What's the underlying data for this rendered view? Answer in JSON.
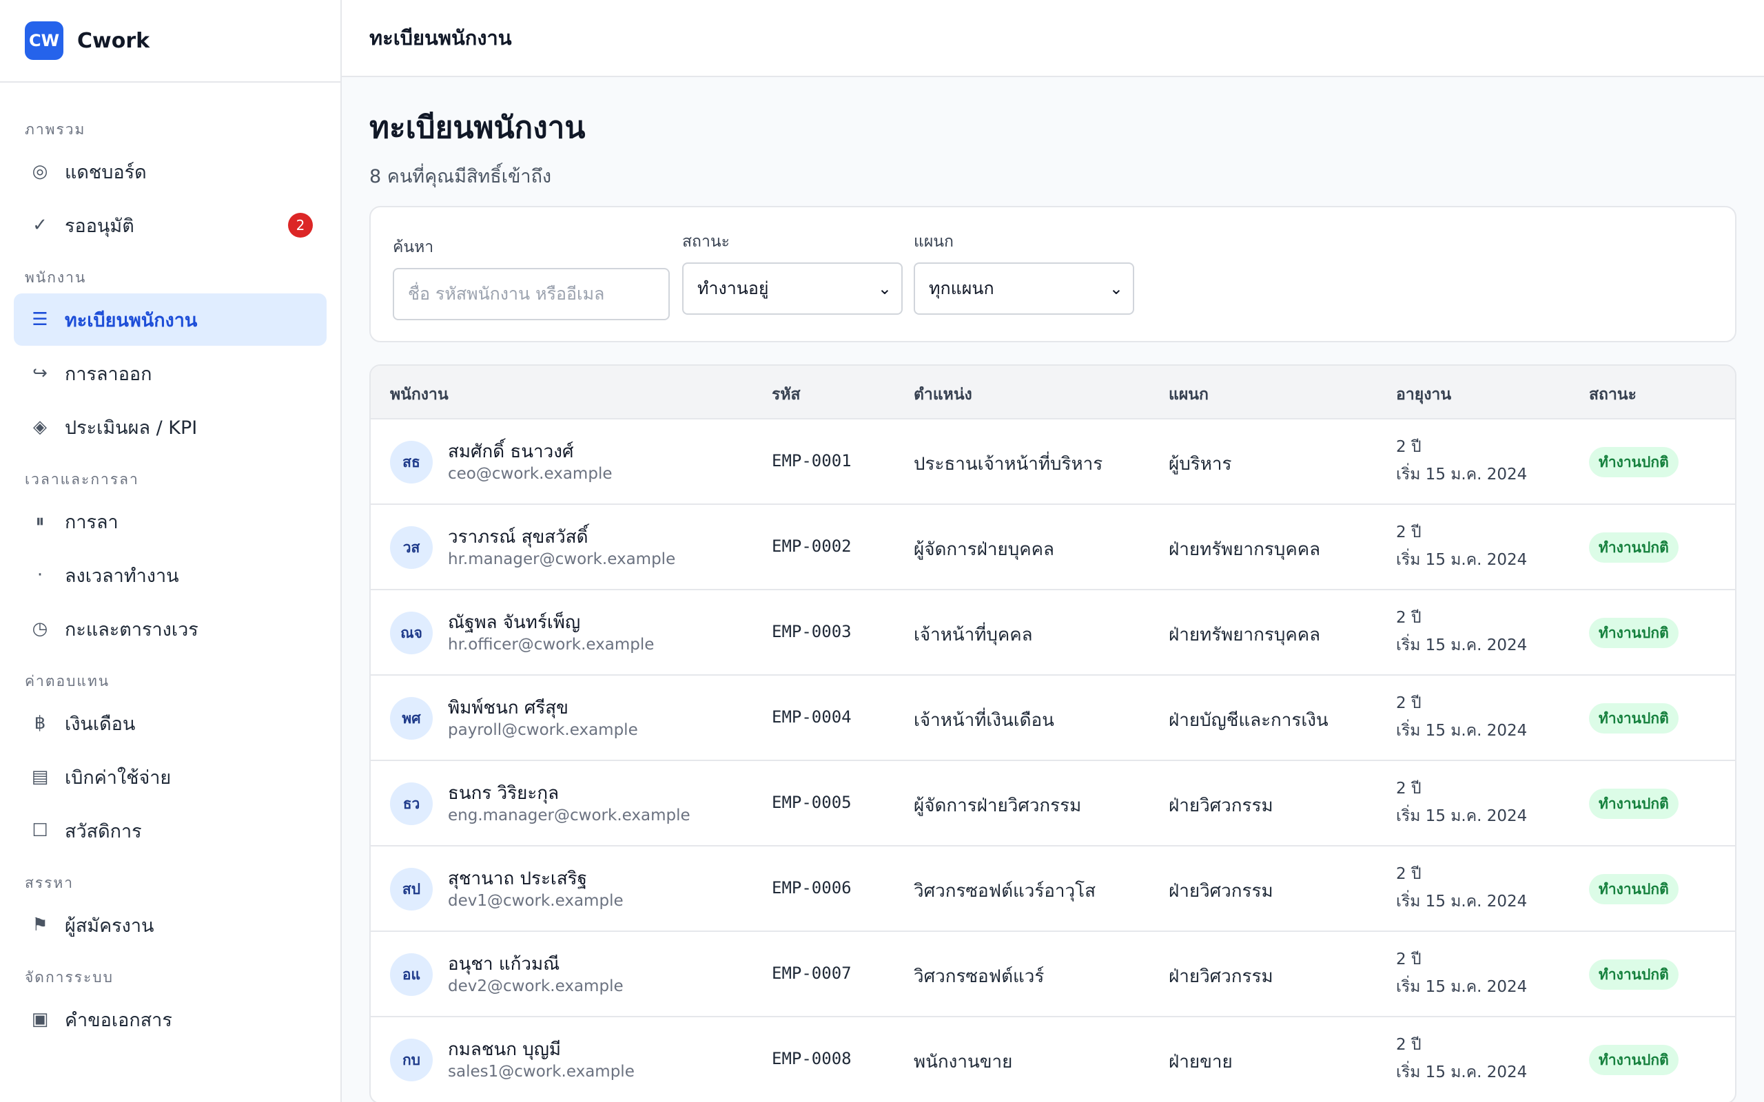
{
  "brand": {
    "logo": "CW",
    "name": "Cwork"
  },
  "sidebar": {
    "groups": [
      {
        "title": "ภาพรวม",
        "items": [
          {
            "icon": "target-icon",
            "glyph": "◎",
            "label": "แดชบอร์ด"
          },
          {
            "icon": "check-icon",
            "glyph": "✓",
            "label": "รออนุมัติ",
            "badge": "2"
          }
        ]
      },
      {
        "title": "พนักงาน",
        "items": [
          {
            "icon": "list-icon",
            "glyph": "☰",
            "label": "ทะเบียนพนักงาน",
            "active": true
          },
          {
            "icon": "exit-arrow-icon",
            "glyph": "↪",
            "label": "การลาออก"
          },
          {
            "icon": "diamond-icon",
            "glyph": "◈",
            "label": "ประเมินผล / KPI"
          }
        ]
      },
      {
        "title": "เวลาและการลา",
        "items": [
          {
            "icon": "pause-icon",
            "glyph": "⏸",
            "label": "การลา"
          },
          {
            "icon": "dot-icon",
            "glyph": "·",
            "label": "ลงเวลาทำงาน"
          },
          {
            "icon": "clock-icon",
            "glyph": "◷",
            "label": "กะและตารางเวร"
          }
        ]
      },
      {
        "title": "ค่าตอบแทน",
        "items": [
          {
            "icon": "baht-icon",
            "glyph": "฿",
            "label": "เงินเดือน"
          },
          {
            "icon": "receipt-icon",
            "glyph": "▤",
            "label": "เบิกค่าใช้จ่าย"
          },
          {
            "icon": "box-icon",
            "glyph": "☐",
            "label": "สวัสดิการ"
          }
        ]
      },
      {
        "title": "สรรหา",
        "items": [
          {
            "icon": "flag-icon",
            "glyph": "⚑",
            "label": "ผู้สมัครงาน"
          }
        ]
      },
      {
        "title": "จัดการระบบ",
        "items": [
          {
            "icon": "document-icon",
            "glyph": "▣",
            "label": "คำขอเอกสาร"
          }
        ]
      }
    ]
  },
  "topbar": {
    "title": "ทะเบียนพนักงาน"
  },
  "page": {
    "title": "ทะเบียนพนักงาน",
    "subtitle": "8 คนที่คุณมีสิทธิ์เข้าถึง"
  },
  "filters": {
    "search_label": "ค้นหา",
    "search_placeholder": "ชื่อ รหัสพนักงาน หรืออีเมล",
    "status_label": "สถานะ",
    "status_value": "ทำงานอยู่",
    "dept_label": "แผนก",
    "dept_value": "ทุกแผนก"
  },
  "table": {
    "headers": [
      "พนักงาน",
      "รหัส",
      "ตำแหน่ง",
      "แผนก",
      "อายุงาน",
      "สถานะ"
    ],
    "rows": [
      {
        "initials": "สธ",
        "name": "สมศักดิ์ ธนาวงศ์",
        "email": "ceo@cwork.example",
        "code": "EMP-0001",
        "position": "ประธานเจ้าหน้าที่บริหาร",
        "dept": "ผู้บริหาร",
        "tenure": "2 ปี",
        "start": "เริ่ม 15 ม.ค. 2024",
        "status": "ทำงานปกติ"
      },
      {
        "initials": "วส",
        "name": "วราภรณ์ สุขสวัสดิ์",
        "email": "hr.manager@cwork.example",
        "code": "EMP-0002",
        "position": "ผู้จัดการฝ่ายบุคคล",
        "dept": "ฝ่ายทรัพยากรบุคคล",
        "tenure": "2 ปี",
        "start": "เริ่ม 15 ม.ค. 2024",
        "status": "ทำงานปกติ"
      },
      {
        "initials": "ณจ",
        "name": "ณัฐพล จันทร์เพ็ญ",
        "email": "hr.officer@cwork.example",
        "code": "EMP-0003",
        "position": "เจ้าหน้าที่บุคคล",
        "dept": "ฝ่ายทรัพยากรบุคคล",
        "tenure": "2 ปี",
        "start": "เริ่ม 15 ม.ค. 2024",
        "status": "ทำงานปกติ"
      },
      {
        "initials": "พศ",
        "name": "พิมพ์ชนก ศรีสุข",
        "email": "payroll@cwork.example",
        "code": "EMP-0004",
        "position": "เจ้าหน้าที่เงินเดือน",
        "dept": "ฝ่ายบัญชีและการเงิน",
        "tenure": "2 ปี",
        "start": "เริ่ม 15 ม.ค. 2024",
        "status": "ทำงานปกติ"
      },
      {
        "initials": "ธว",
        "name": "ธนกร วิริยะกุล",
        "email": "eng.manager@cwork.example",
        "code": "EMP-0005",
        "position": "ผู้จัดการฝ่ายวิศวกรรม",
        "dept": "ฝ่ายวิศวกรรม",
        "tenure": "2 ปี",
        "start": "เริ่ม 15 ม.ค. 2024",
        "status": "ทำงานปกติ"
      },
      {
        "initials": "สป",
        "name": "สุชานาถ ประเสริฐ",
        "email": "dev1@cwork.example",
        "code": "EMP-0006",
        "position": "วิศวกรซอฟต์แวร์อาวุโส",
        "dept": "ฝ่ายวิศวกรรม",
        "tenure": "2 ปี",
        "start": "เริ่ม 15 ม.ค. 2024",
        "status": "ทำงานปกติ"
      },
      {
        "initials": "อแ",
        "name": "อนุชา แก้วมณี",
        "email": "dev2@cwork.example",
        "code": "EMP-0007",
        "position": "วิศวกรซอฟต์แวร์",
        "dept": "ฝ่ายวิศวกรรม",
        "tenure": "2 ปี",
        "start": "เริ่ม 15 ม.ค. 2024",
        "status": "ทำงานปกติ"
      },
      {
        "initials": "กบ",
        "name": "กมลชนก บุญมี",
        "email": "sales1@cwork.example",
        "code": "EMP-0008",
        "position": "พนักงานขาย",
        "dept": "ฝ่ายขาย",
        "tenure": "2 ปี",
        "start": "เริ่ม 15 ม.ค. 2024",
        "status": "ทำงานปกติ"
      }
    ]
  },
  "colors": {
    "accent": "#2563eb",
    "active_bg": "#e0edff",
    "badge": "#dc2626",
    "status_bg": "#dcfce7",
    "status_text": "#15803d"
  }
}
